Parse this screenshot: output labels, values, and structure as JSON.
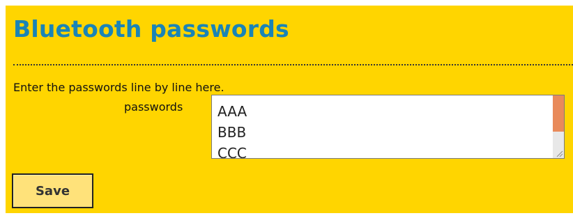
{
  "page": {
    "title": "Bluetooth passwords"
  },
  "form": {
    "intro": "Enter the passwords line by line here.",
    "passwords_label": "passwords",
    "passwords_value": "AAA\nBBB\nCCC",
    "save_label": "Save"
  },
  "colors": {
    "background": "#ffd500",
    "title": "#1a84b6",
    "scrollbar_thumb": "#e98a5a"
  }
}
